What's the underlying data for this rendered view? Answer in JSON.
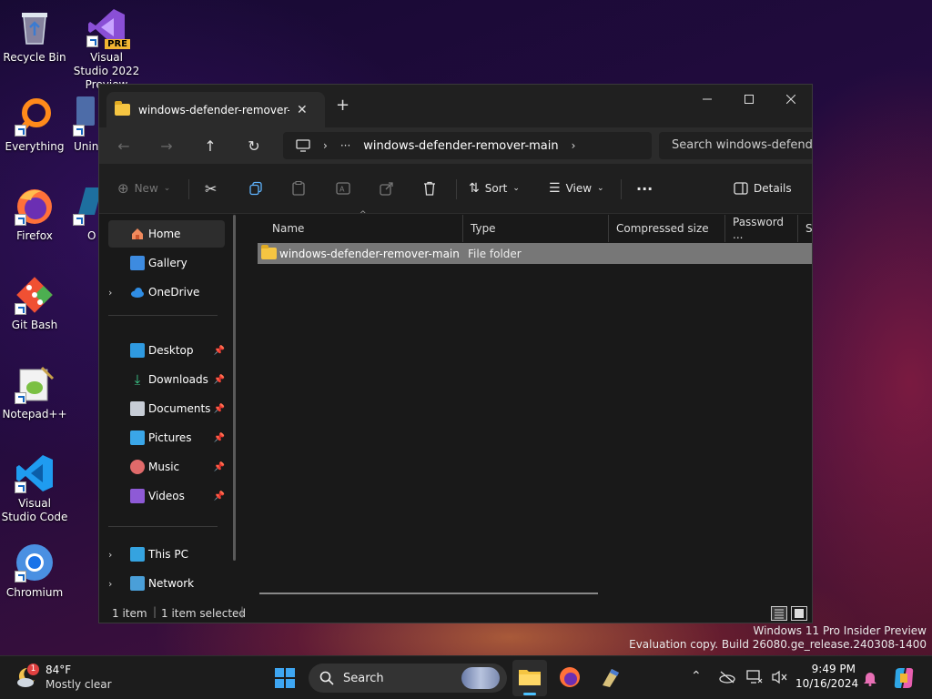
{
  "desktop": {
    "icons": [
      {
        "label": "Recycle Bin"
      },
      {
        "label": "Visual Studio 2022 Preview",
        "badge": "PRE"
      },
      {
        "label": "Everything"
      },
      {
        "label": "Unins"
      },
      {
        "label": "Firefox"
      },
      {
        "label": "O Virt"
      },
      {
        "label": "Git Bash"
      },
      {
        "label": "Notepad++"
      },
      {
        "label": "Visual Studio Code"
      },
      {
        "label": "Chromium"
      }
    ]
  },
  "explorer": {
    "tab_title": "windows-defender-remover-main",
    "address_path": "windows-defender-remover-main",
    "search_placeholder": "Search windows-defender-remover-main",
    "commands": {
      "new": "New",
      "sort": "Sort",
      "view": "View",
      "details": "Details"
    },
    "nav": [
      {
        "label": "Home",
        "pinned": false
      },
      {
        "label": "Gallery",
        "pinned": false
      },
      {
        "label": "OneDrive",
        "pinned": false
      },
      {
        "label": "Desktop",
        "pinned": true
      },
      {
        "label": "Downloads",
        "pinned": true
      },
      {
        "label": "Documents",
        "pinned": true
      },
      {
        "label": "Pictures",
        "pinned": true
      },
      {
        "label": "Music",
        "pinned": true
      },
      {
        "label": "Videos",
        "pinned": true
      },
      {
        "label": "This PC",
        "pinned": false
      },
      {
        "label": "Network",
        "pinned": false
      }
    ],
    "columns": [
      "Name",
      "Type",
      "Compressed size",
      "Password ...",
      "Si"
    ],
    "rows": [
      {
        "name": "windows-defender-remover-main",
        "type": "File folder"
      }
    ],
    "status": {
      "count": "1 item",
      "selected": "1 item selected"
    }
  },
  "watermark": {
    "line1": "Windows 11 Pro Insider Preview",
    "line2": "Evaluation copy. Build 26080.ge_release.240308-1400"
  },
  "taskbar": {
    "weather_temp": "84°F",
    "weather_desc": "Mostly clear",
    "weather_badge": "1",
    "search_label": "Search",
    "time": "9:49 PM",
    "date": "10/16/2024"
  },
  "colors": {
    "accent": "#4cc2ff",
    "folder": "#f5c542"
  }
}
